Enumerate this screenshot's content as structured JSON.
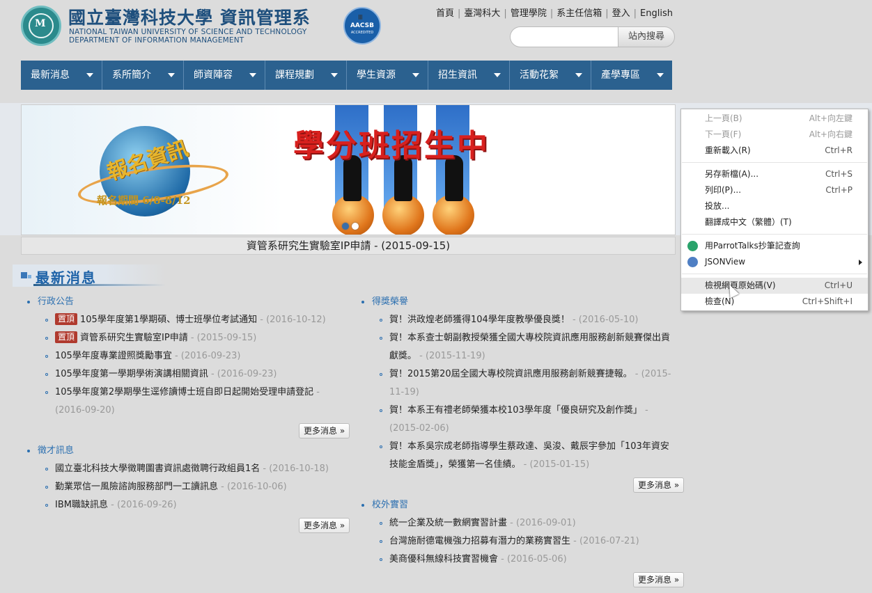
{
  "header": {
    "title_zh": "國立臺灣科技大學 資訊管理系",
    "title_en_line1": "NATIONAL TAIWAN UNIVERSITY OF SCIENCE AND TECHNOLOGY",
    "title_en_line2": "DEPARTMENT OF INFORMATION MANAGEMENT",
    "aacsb_text": "AACSB",
    "aacsb_sub": "ACCREDITED",
    "top_links": [
      "首頁",
      "臺灣科大",
      "管理學院",
      "系主任信箱",
      "登入",
      "English"
    ],
    "search_placeholder": "",
    "search_button": "站內搜尋"
  },
  "nav": {
    "items": [
      "最新消息",
      "系所簡介",
      "師資陣容",
      "課程規劃",
      "學生資源",
      "招生資訊",
      "活動花絮",
      "產學專區"
    ]
  },
  "banner": {
    "headline": "學分班招生中",
    "badge_text": "報名資訊",
    "period": "報名期間 6/8-8/12",
    "caption": "資管系研究生實驗室IP申請 - (2015-09-15)"
  },
  "news": {
    "section_title": "最新消息",
    "more_label": "更多消息 »",
    "left": [
      {
        "category": "行政公告",
        "items": [
          {
            "pin": "置頂",
            "title": "105學年度第1學期碩、博士班學位考試通知",
            "date": " - (2016-10-12)"
          },
          {
            "pin": "置頂",
            "title": "資管系研究生實驗室IP申請",
            "date": " - (2015-09-15)"
          },
          {
            "pin": "",
            "title": "105學年度專業證照獎勵事宜",
            "date": " - (2016-09-23)"
          },
          {
            "pin": "",
            "title": "105學年度第一學期學術演講相關資訊",
            "date": " - (2016-09-23)"
          },
          {
            "pin": "",
            "title": "105學年度第2學期學生逕修讀博士班自即日起開始受理申請登記",
            "date": " - (2016-09-20)"
          }
        ]
      },
      {
        "category": "徵才訊息",
        "items": [
          {
            "pin": "",
            "title": "國立臺北科技大學徵聘圖書資訊處徵聘行政組員1名",
            "date": " - (2016-10-18)"
          },
          {
            "pin": "",
            "title": "勤業眾信一風險諮詢服務部門一工讀訊息",
            "date": " - (2016-10-06)"
          },
          {
            "pin": "",
            "title": "IBM職缺訊息",
            "date": " - (2016-09-26)"
          }
        ]
      }
    ],
    "right": [
      {
        "category": "得獎榮譽",
        "items": [
          {
            "title": "賀！洪政煌老師獲得104學年度教學優良獎！",
            "date": " - (2016-05-10)"
          },
          {
            "title": "賀！本系查士朝副教授榮獲全國大專校院資訊應用服務創新競賽傑出貢獻獎。",
            "date": " - (2015-11-19)"
          },
          {
            "title": "賀！2015第20屆全國大專校院資訊應用服務創新競賽捷報。",
            "date": " - (2015-11-19)"
          },
          {
            "title": "賀！本系王有禮老師榮獲本校103學年度「優良研究及創作獎」",
            "date": " - (2015-02-06)"
          },
          {
            "title": "賀！本系吳宗成老師指導學生蔡政達、吳浚、戴辰宇參加「103年資安技能金盾獎」，榮獲第一名佳績。",
            "date": " - (2015-01-15)"
          }
        ]
      },
      {
        "category": "校外實習",
        "items": [
          {
            "title": "統一企業及統一數網實習計畫",
            "date": " - (2016-09-01)"
          },
          {
            "title": "台灣施耐德電機強力招募有潛力的業務實習生",
            "date": " - (2016-07-21)"
          },
          {
            "title": "美商優科無線科技實習機會",
            "date": " - (2016-05-06)"
          }
        ]
      }
    ]
  },
  "context_menu": {
    "items": [
      {
        "label": "上一頁(B)",
        "shortcut": "Alt+向左鍵"
      },
      {
        "label": "下一頁(F)",
        "shortcut": "Alt+向右鍵"
      },
      {
        "label": "重新載入(R)",
        "shortcut": "Ctrl+R"
      },
      {
        "label": "另存新檔(A)...",
        "shortcut": "Ctrl+S"
      },
      {
        "label": "列印(P)...",
        "shortcut": "Ctrl+P"
      },
      {
        "label": "投放...",
        "shortcut": ""
      },
      {
        "label": "翻譯成中文（繁體）(T)",
        "shortcut": ""
      },
      {
        "label": "用ParrotTalks抄筆記查詢",
        "shortcut": ""
      },
      {
        "label": "JSONView",
        "shortcut": ""
      },
      {
        "label": "檢視網頁原始碼(V)",
        "shortcut": "Ctrl+U"
      },
      {
        "label": "檢查(N)",
        "shortcut": "Ctrl+Shift+I"
      }
    ]
  },
  "colors": {
    "nav_bg": "#2b618f",
    "pin_bg": "#b03a2e",
    "link_blue": "#2b6fb0"
  }
}
